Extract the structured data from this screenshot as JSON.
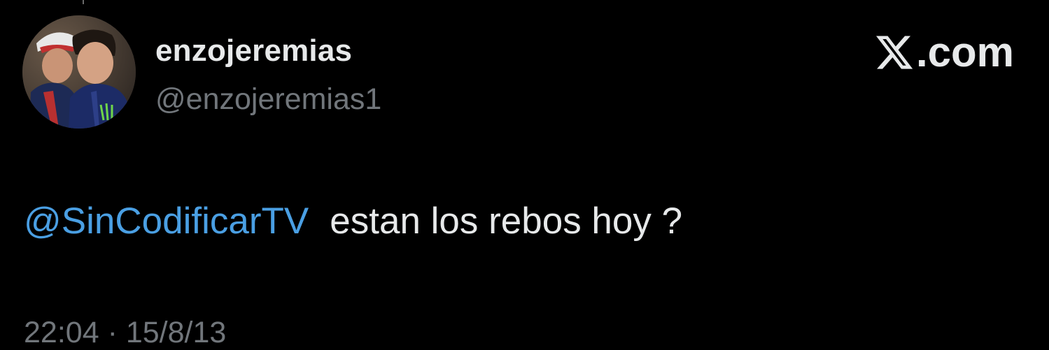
{
  "tweet": {
    "display_name": "enzojeremias",
    "handle": "@enzojeremias1",
    "mention": "@SinCodificarTV",
    "text": "estan los rebos hoy ?",
    "time": "22:04",
    "separator": "·",
    "date": "15/8/13"
  },
  "brand": {
    "label": ".com",
    "icon": "x-logo-icon"
  },
  "colors": {
    "background": "#000000",
    "primary_text": "#e7e9ea",
    "secondary_text": "#71767b",
    "mention": "#4a9fe3"
  },
  "avatar": {
    "icon": "profile-photo"
  }
}
